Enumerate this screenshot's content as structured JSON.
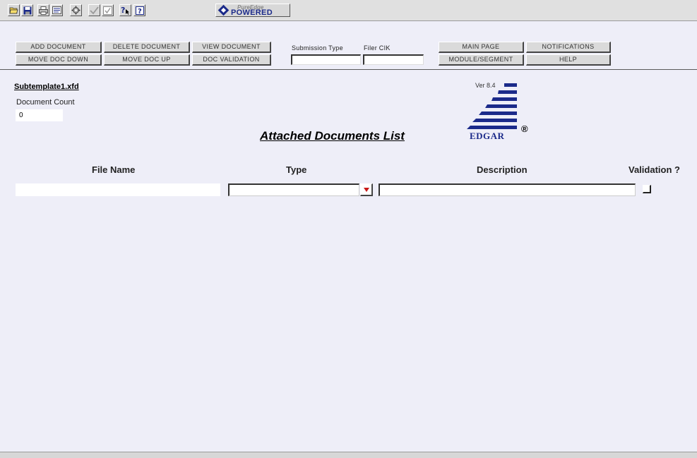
{
  "toolbar": {
    "icons": [
      "open-folder-icon",
      "save-icon",
      "print-icon",
      "preview-icon",
      "settings-icon",
      "check-icon",
      "checklist-icon",
      "pointer-help-icon",
      "help-icon"
    ],
    "logo_small_text": "PureEdge",
    "logo_text": "POWERED"
  },
  "header": {
    "buttons": {
      "add_document": "ADD DOCUMENT",
      "delete_document": "DELETE DOCUMENT",
      "view_document": "VIEW DOCUMENT",
      "move_doc_down": "MOVE DOC DOWN",
      "move_doc_up": "MOVE DOC UP",
      "doc_validation": "DOC VALIDATION",
      "main_page": "MAIN PAGE",
      "notifications": "NOTIFICATIONS",
      "module_segment": "MODULE/SEGMENT",
      "help": "HELP"
    },
    "submission_type_label": "Submission Type",
    "filer_cik_label": "Filer CIK",
    "submission_type_value": "",
    "filer_cik_value": ""
  },
  "main": {
    "filename": "Subtemplate1.xfd",
    "document_count_label": "Document Count",
    "document_count_value": "0",
    "title": "Attached Documents List",
    "logo": {
      "version": "Ver 8.4",
      "brand": "EDGAR",
      "reg": "®"
    },
    "columns": {
      "file_name": "File Name",
      "type": "Type",
      "description": "Description",
      "validation": "Validation ?"
    },
    "row": {
      "file_name": "",
      "type": "",
      "description": "",
      "validation_checked": false
    }
  },
  "colors": {
    "background": "#eeeef8",
    "accent_blue": "#1b2a8a",
    "dropdown_arrow": "#c81818"
  }
}
